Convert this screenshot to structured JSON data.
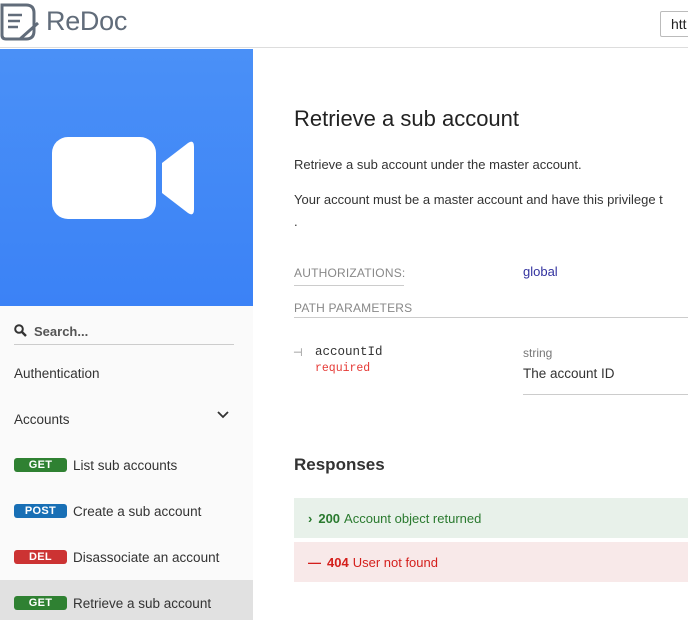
{
  "header": {
    "logo_text": "ReDoc",
    "url_value": "htt"
  },
  "sidebar": {
    "search_placeholder": "Search...",
    "items": [
      {
        "label": "Authentication"
      },
      {
        "label": "Accounts"
      },
      {
        "method": "GET",
        "label": "List sub accounts"
      },
      {
        "method": "POST",
        "label": "Create a sub account"
      },
      {
        "method": "DEL",
        "label": "Disassociate an account"
      },
      {
        "method": "GET",
        "label": "Retrieve a sub account"
      }
    ]
  },
  "operation": {
    "title": "Retrieve a sub account",
    "description_1": "Retrieve a sub account under the master account.",
    "description_2": "Your account must be a master account and have this privilege t",
    "description_3": ".",
    "authorizations_label": "AUTHORIZATIONS:",
    "authorizations_value": "global",
    "path_params_label": "PATH PARAMETERS",
    "params": [
      {
        "name": "accountId",
        "required": "required",
        "type": "string",
        "description": "The account ID"
      }
    ],
    "responses_title": "Responses",
    "responses": [
      {
        "code": "200",
        "text": "Account object returned",
        "marker": "›"
      },
      {
        "code": "404",
        "text": "User not found",
        "marker": "—"
      }
    ]
  },
  "colors": {
    "brand_blue": "#4a90f7",
    "get": "#2f8132",
    "post": "#186fb5",
    "del": "#cc3333",
    "link": "#32329f"
  }
}
